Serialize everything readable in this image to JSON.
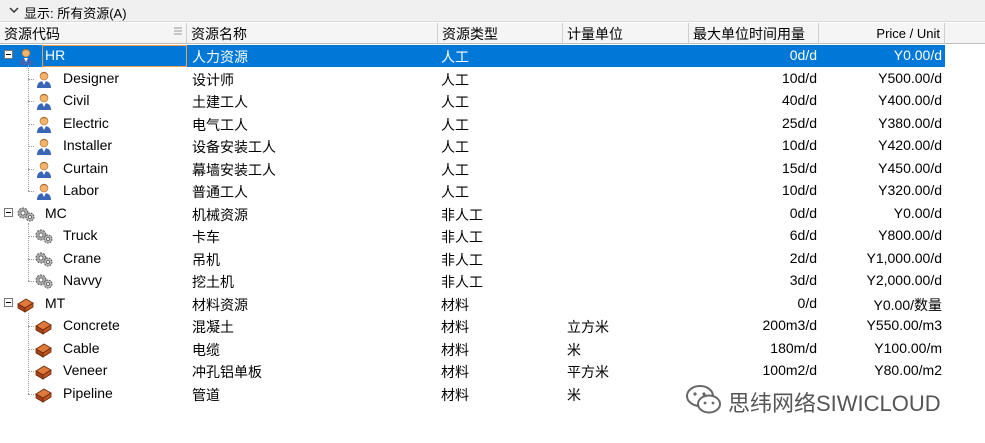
{
  "filter": {
    "label": "显示: 所有资源(A)"
  },
  "columns": [
    {
      "key": "code",
      "label": "资源代码"
    },
    {
      "key": "name",
      "label": "资源名称"
    },
    {
      "key": "type",
      "label": "资源类型"
    },
    {
      "key": "unit",
      "label": "计量单位"
    },
    {
      "key": "max",
      "label": "最大单位时间用量"
    },
    {
      "key": "price",
      "label": "Price / Unit"
    }
  ],
  "rows": [
    {
      "code": "HR",
      "name": "人力资源",
      "type": "人工",
      "unit": "",
      "max": "0d/d",
      "price": "Y0.00/d",
      "level": 0,
      "icon": "person-icon",
      "selected": true
    },
    {
      "code": "Designer",
      "name": "设计师",
      "type": "人工",
      "unit": "",
      "max": "10d/d",
      "price": "Y500.00/d",
      "level": 1,
      "icon": "person-icon"
    },
    {
      "code": "Civil",
      "name": "土建工人",
      "type": "人工",
      "unit": "",
      "max": "40d/d",
      "price": "Y400.00/d",
      "level": 1,
      "icon": "person-icon"
    },
    {
      "code": "Electric",
      "name": "电气工人",
      "type": "人工",
      "unit": "",
      "max": "25d/d",
      "price": "Y380.00/d",
      "level": 1,
      "icon": "person-icon"
    },
    {
      "code": "Installer",
      "name": "设备安装工人",
      "type": "人工",
      "unit": "",
      "max": "10d/d",
      "price": "Y420.00/d",
      "level": 1,
      "icon": "person-icon"
    },
    {
      "code": "Curtain",
      "name": "幕墙安装工人",
      "type": "人工",
      "unit": "",
      "max": "15d/d",
      "price": "Y450.00/d",
      "level": 1,
      "icon": "person-icon"
    },
    {
      "code": "Labor",
      "name": "普通工人",
      "type": "人工",
      "unit": "",
      "max": "10d/d",
      "price": "Y320.00/d",
      "level": 1,
      "icon": "person-icon"
    },
    {
      "code": "MC",
      "name": "机械资源",
      "type": "非人工",
      "unit": "",
      "max": "0d/d",
      "price": "Y0.00/d",
      "level": 0,
      "icon": "gears-icon"
    },
    {
      "code": "Truck",
      "name": "卡车",
      "type": "非人工",
      "unit": "",
      "max": "6d/d",
      "price": "Y800.00/d",
      "level": 1,
      "icon": "gears-icon"
    },
    {
      "code": "Crane",
      "name": "吊机",
      "type": "非人工",
      "unit": "",
      "max": "2d/d",
      "price": "Y1,000.00/d",
      "level": 1,
      "icon": "gears-icon"
    },
    {
      "code": "Navvy",
      "name": "挖土机",
      "type": "非人工",
      "unit": "",
      "max": "3d/d",
      "price": "Y2,000.00/d",
      "level": 1,
      "icon": "gears-icon"
    },
    {
      "code": "MT",
      "name": "材料资源",
      "type": "材料",
      "unit": "",
      "max": "0/d",
      "price": "Y0.00/数量",
      "level": 0,
      "icon": "material-icon"
    },
    {
      "code": "Concrete",
      "name": "混凝土",
      "type": "材料",
      "unit": "立方米",
      "max": "200m3/d",
      "price": "Y550.00/m3",
      "level": 1,
      "icon": "material-icon"
    },
    {
      "code": "Cable",
      "name": "电缆",
      "type": "材料",
      "unit": "米",
      "max": "180m/d",
      "price": "Y100.00/m",
      "level": 1,
      "icon": "material-icon"
    },
    {
      "code": "Veneer",
      "name": "冲孔铝单板",
      "type": "材料",
      "unit": "平方米",
      "max": "100m2/d",
      "price": "Y80.00/m2",
      "level": 1,
      "icon": "material-icon"
    },
    {
      "code": "Pipeline",
      "name": "管道",
      "type": "材料",
      "unit": "米",
      "max": "",
      "price": "",
      "level": 1,
      "icon": "material-icon"
    }
  ],
  "watermark": {
    "text": "思纬网络SIWICLOUD",
    "icon": "wechat-icon"
  },
  "colors": {
    "selection": "#0078d7",
    "header_bg": "#f5f5f5"
  }
}
